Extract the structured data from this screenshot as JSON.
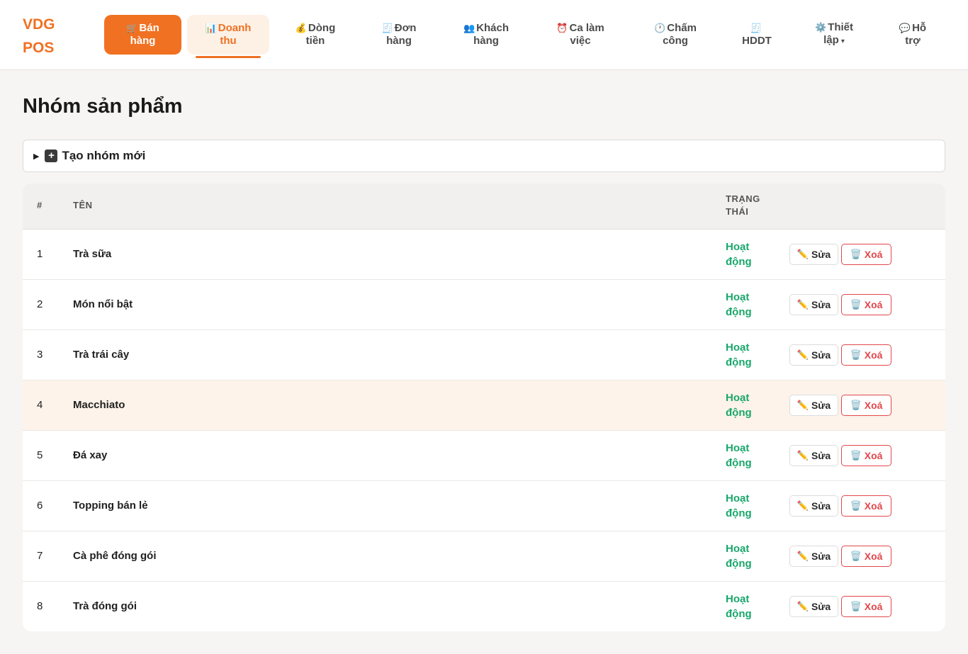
{
  "brand": {
    "line1": "VDG",
    "line2": "POS",
    "color": "#f07122"
  },
  "nav": [
    {
      "icon": "🛒",
      "icon_name": "cart-icon",
      "line1": "Bán",
      "line2": "hàng",
      "state": "primary"
    },
    {
      "icon": "📊",
      "icon_name": "bar-chart-icon",
      "line1": "Doanh",
      "line2": "thu",
      "state": "active"
    },
    {
      "icon": "💰",
      "icon_name": "money-bag-icon",
      "line1": "Dòng",
      "line2": "tiền",
      "state": ""
    },
    {
      "icon": "🧾",
      "icon_name": "receipt-icon",
      "line1": "Đơn",
      "line2": "hàng",
      "state": ""
    },
    {
      "icon": "👥",
      "icon_name": "users-icon",
      "line1": "Khách",
      "line2": "hàng",
      "state": ""
    },
    {
      "icon": "⏰",
      "icon_name": "alarm-clock-icon",
      "line1": "Ca làm",
      "line2": "việc",
      "state": ""
    },
    {
      "icon": "🕐",
      "icon_name": "clock-icon",
      "line1": "Chấm",
      "line2": "công",
      "state": ""
    },
    {
      "icon": "🧾",
      "icon_name": "invoice-icon",
      "line1": "",
      "line2": "HDDT",
      "state": ""
    },
    {
      "icon": "⚙️",
      "icon_name": "gear-icon",
      "line1": "Thiết",
      "line2": "lập",
      "state": "",
      "caret": "▾"
    },
    {
      "icon": "💬",
      "icon_name": "chat-icon",
      "line1": "Hỗ",
      "line2": "trợ",
      "state": ""
    }
  ],
  "page": {
    "title": "Nhóm sản phẩm"
  },
  "create_group": {
    "toggle": "▶",
    "plus": "+",
    "label": "Tạo nhóm mới"
  },
  "table": {
    "headers": {
      "index": "#",
      "name": "TÊN",
      "status_line1": "TRẠNG",
      "status_line2": "THÁI"
    },
    "edit_label": "Sửa",
    "edit_icon": "✏️",
    "delete_label": "Xoá",
    "delete_icon": "🗑️",
    "rows": [
      {
        "index": "1",
        "name": "Trà sữa",
        "status_line1": "Hoạt",
        "status_line2": "động"
      },
      {
        "index": "2",
        "name": "Món nổi bật",
        "status_line1": "Hoạt",
        "status_line2": "động"
      },
      {
        "index": "3",
        "name": "Trà trái cây",
        "status_line1": "Hoạt",
        "status_line2": "động"
      },
      {
        "index": "4",
        "name": "Macchiato",
        "status_line1": "Hoạt",
        "status_line2": "động",
        "highlighted": true
      },
      {
        "index": "5",
        "name": "Đá xay",
        "status_line1": "Hoạt",
        "status_line2": "động"
      },
      {
        "index": "6",
        "name": "Topping bán lẻ",
        "status_line1": "Hoạt",
        "status_line2": "động"
      },
      {
        "index": "7",
        "name": "Cà phê đóng gói",
        "status_line1": "Hoạt",
        "status_line2": "động"
      },
      {
        "index": "8",
        "name": "Trà đóng gói",
        "status_line1": "Hoạt",
        "status_line2": "động"
      }
    ]
  },
  "colors": {
    "accent": "#f07122",
    "status_active": "#1aa66b",
    "danger": "#e2474b"
  }
}
